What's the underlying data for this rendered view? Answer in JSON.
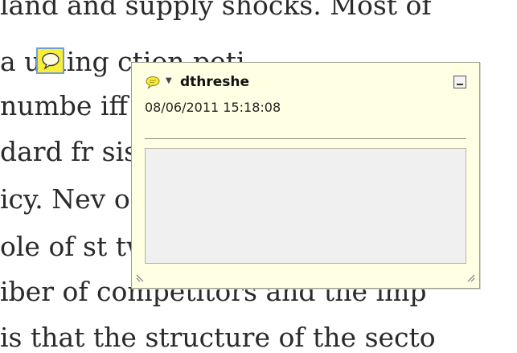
{
  "document": {
    "lines": [
      "land and supply shocks. Most of",
      "a  uming                    ction    peti",
      "numbe                                 iff",
      "dard fr                               sis",
      "icy. Nev                              o  c",
      "ole of st                             tw",
      "iber of competitors and the imp",
      " is that the structure of the secto"
    ]
  },
  "popup": {
    "author": "dthreshe",
    "timestamp": "08/06/2011 15:18:08",
    "comment_text": ""
  },
  "colors": {
    "popup_background": "#ffffe4",
    "icon_yellow": "#f7ee3a",
    "icon_border": "#6f9fd6",
    "comment_area": "#f0f0f0"
  },
  "icons": [
    "speech-bubble-icon",
    "chevron-down-icon",
    "minimize-icon",
    "resize-grip-icon"
  ]
}
